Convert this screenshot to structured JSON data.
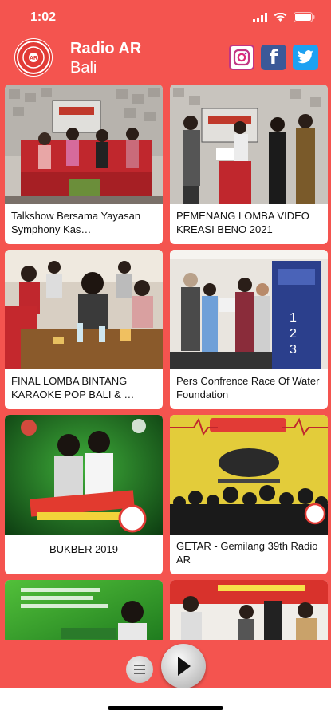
{
  "status": {
    "time": "1:02"
  },
  "header": {
    "title": "Radio AR",
    "subtitle": "Bali",
    "logo_text": "RADIO AR BALI"
  },
  "social": [
    "instagram-icon",
    "facebook-icon",
    "twitter-icon"
  ],
  "cards": [
    {
      "caption": "Talkshow Bersama Yayasan Symphony Kas…"
    },
    {
      "caption": "PEMENANG LOMBA VIDEO KREASI BENO 2021"
    },
    {
      "caption": "FINAL LOMBA BINTANG KARAOKE POP BALI & …"
    },
    {
      "caption": "Pers Confrence Race Of Water Foundation"
    },
    {
      "caption": "BUKBER 2019"
    },
    {
      "caption": "GETAR - Gemilang 39th Radio AR"
    }
  ],
  "colors": {
    "accent": "#f4544f",
    "card": "#ffffff"
  }
}
